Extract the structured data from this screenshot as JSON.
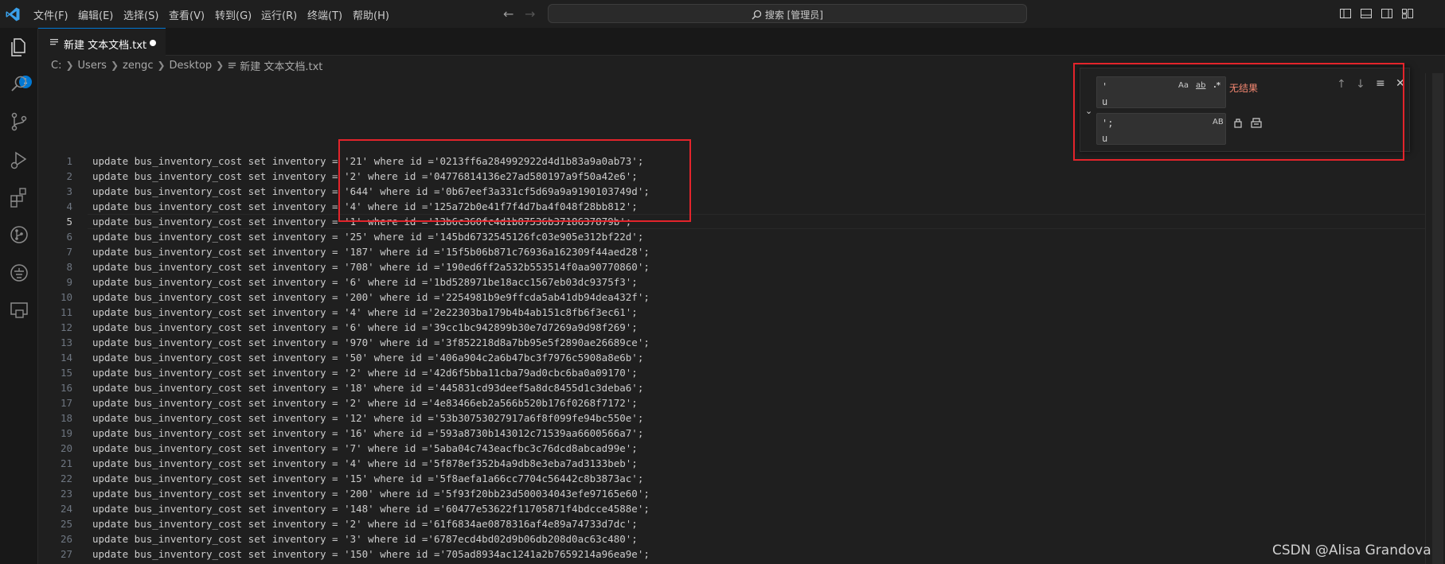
{
  "menu": [
    "文件(F)",
    "编辑(E)",
    "选择(S)",
    "查看(V)",
    "转到(G)",
    "运行(R)",
    "终端(T)",
    "帮助(H)"
  ],
  "search": {
    "label": "搜索 [管理员]"
  },
  "activity": {
    "explorer_badge": "1"
  },
  "tab": {
    "label": "新建 文本文档.txt"
  },
  "breadcrumb": [
    "C:",
    "Users",
    "zengc",
    "Desktop",
    "新建 文本文档.txt"
  ],
  "find": {
    "find_value": "'\nu",
    "replace_value": "';\nu",
    "match_case": "Aa",
    "whole_word": "ab",
    "regex": ".*",
    "preserve_case": "AB",
    "status": "无结果"
  },
  "editor": {
    "active_line": 5,
    "lines": [
      {
        "n": "1",
        "text": "update bus_inventory_cost set inventory = '21' where id ='0213ff6a284992922d4d1b83a9a0ab73';"
      },
      {
        "n": "2",
        "text": "update bus_inventory_cost set inventory = '2' where id ='04776814136e27ad580197a9f50a42e6';"
      },
      {
        "n": "3",
        "text": "update bus_inventory_cost set inventory = '644' where id ='0b67eef3a331cf5d69a9a9190103749d';"
      },
      {
        "n": "4",
        "text": "update bus_inventory_cost set inventory = '4' where id ='125a72b0e41f7f4d7ba4f048f28bb812';"
      },
      {
        "n": "5",
        "text": "update bus_inventory_cost set inventory = '1' where id ='13b6c360fc4d1b87536b3718637879b';"
      },
      {
        "n": "6",
        "text": "update bus_inventory_cost set inventory = '25' where id ='145bd6732545126fc03e905e312bf22d';"
      },
      {
        "n": "7",
        "text": "update bus_inventory_cost set inventory = '187' where id ='15f5b06b871c76936a162309f44aed28';"
      },
      {
        "n": "8",
        "text": "update bus_inventory_cost set inventory = '708' where id ='190ed6ff2a532b553514f0aa90770860';"
      },
      {
        "n": "9",
        "text": "update bus_inventory_cost set inventory = '6' where id ='1bd528971be18acc1567eb03dc9375f3';"
      },
      {
        "n": "10",
        "text": "update bus_inventory_cost set inventory = '200' where id ='2254981b9e9ffcda5ab41db94dea432f';"
      },
      {
        "n": "11",
        "text": "update bus_inventory_cost set inventory = '4' where id ='2e22303ba179b4b4ab151c8fb6f3ec61';"
      },
      {
        "n": "12",
        "text": "update bus_inventory_cost set inventory = '6' where id ='39cc1bc942899b30e7d7269a9d98f269';"
      },
      {
        "n": "13",
        "text": "update bus_inventory_cost set inventory = '970' where id ='3f852218d8a7bb95e5f2890ae26689ce';"
      },
      {
        "n": "14",
        "text": "update bus_inventory_cost set inventory = '50' where id ='406a904c2a6b47bc3f7976c5908a8e6b';"
      },
      {
        "n": "15",
        "text": "update bus_inventory_cost set inventory = '2' where id ='42d6f5bba11cba79ad0cbc6ba0a09170';"
      },
      {
        "n": "16",
        "text": "update bus_inventory_cost set inventory = '18' where id ='445831cd93deef5a8dc8455d1c3deba6';"
      },
      {
        "n": "17",
        "text": "update bus_inventory_cost set inventory = '2' where id ='4e83466eb2a566b520b176f0268f7172';"
      },
      {
        "n": "18",
        "text": "update bus_inventory_cost set inventory = '12' where id ='53b30753027917a6f8f099fe94bc550e';"
      },
      {
        "n": "19",
        "text": "update bus_inventory_cost set inventory = '16' where id ='593a8730b143012c71539aa6600566a7';"
      },
      {
        "n": "20",
        "text": "update bus_inventory_cost set inventory = '7' where id ='5aba04c743eacfbc3c76dcd8abcad99e';"
      },
      {
        "n": "21",
        "text": "update bus_inventory_cost set inventory = '4' where id ='5f878ef352b4a9db8e3eba7ad3133beb';"
      },
      {
        "n": "22",
        "text": "update bus_inventory_cost set inventory = '15' where id ='5f8aefa1a66cc7704c56442c8b3873ac';"
      },
      {
        "n": "23",
        "text": "update bus_inventory_cost set inventory = '200' where id ='5f93f20bb23d500034043efe97165e60';"
      },
      {
        "n": "24",
        "text": "update bus_inventory_cost set inventory = '148' where id ='60477e53622f11705871f4bdcce4588e';"
      },
      {
        "n": "25",
        "text": "update bus_inventory_cost set inventory = '2' where id ='61f6834ae0878316af4e89a74733d7dc';"
      },
      {
        "n": "26",
        "text": "update bus_inventory_cost set inventory = '3' where id ='6787ecd4bd02d9b06db208d0ac63c480';"
      },
      {
        "n": "27",
        "text": "update bus_inventory_cost set inventory = '150' where id ='705ad8934ac1241a2b7659214a96ea9e';"
      }
    ]
  },
  "watermark": "CSDN @Alisa Grandova",
  "colors": {
    "accent": "#0078d4",
    "annotation_red": "#e3242b",
    "no_results": "#f48771"
  }
}
